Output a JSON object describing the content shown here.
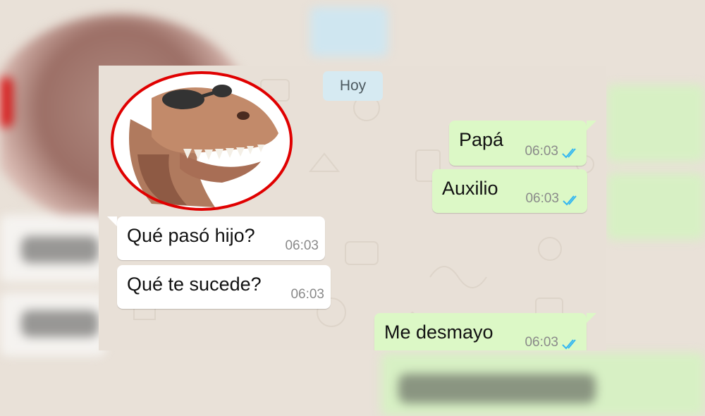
{
  "date_separator": "Hoy",
  "messages": [
    {
      "direction": "out",
      "text": "Papá",
      "time": "06:03",
      "status": "read"
    },
    {
      "direction": "out",
      "text": "Auxilio",
      "time": "06:03",
      "status": "read"
    },
    {
      "direction": "in",
      "text": "Qué pasó hijo?",
      "time": "06:03"
    },
    {
      "direction": "in",
      "text": "Qué te sucede?",
      "time": "06:03"
    },
    {
      "direction": "out",
      "text": "Me desmayo",
      "time": "06:03",
      "status": "read"
    }
  ],
  "sticker": {
    "icon": "dinosaur-sticker-icon",
    "highlight_color": "#e00000"
  },
  "colors": {
    "incoming": "#ffffff",
    "outgoing": "#dcf8c6",
    "read_ticks": "#34b7f1",
    "date_pill": "#d6eaf2"
  }
}
